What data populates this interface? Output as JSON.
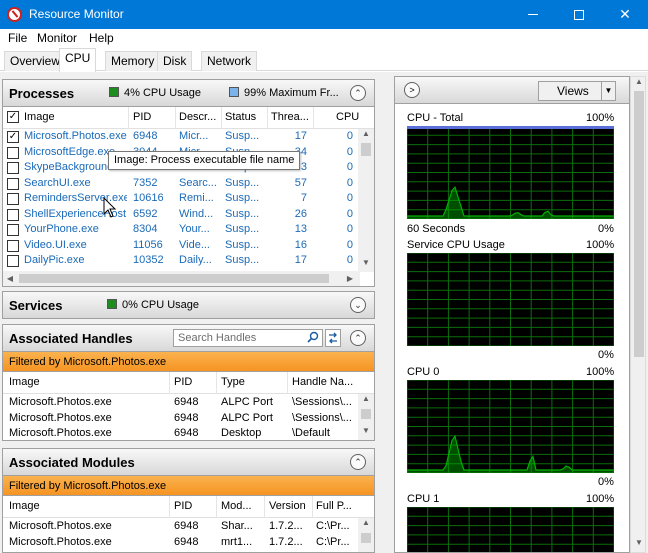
{
  "window": {
    "title": "Resource Monitor"
  },
  "menu": [
    "File",
    "Monitor",
    "Help"
  ],
  "tabs": [
    "Overview",
    "CPU",
    "Memory",
    "Disk",
    "Network"
  ],
  "processes": {
    "title": "Processes",
    "cpu_usage": "4% CPU Usage",
    "max_freq": "99% Maximum Fr...",
    "usage_color": "#1e8c1e",
    "freq_color": "#7ab4ea",
    "columns": [
      "Image",
      "PID",
      "Descr...",
      "Status",
      "Threa...",
      "CPU"
    ],
    "rows": [
      {
        "checked": true,
        "image": "Microsoft.Photos.exe",
        "pid": "6948",
        "desc": "Micr...",
        "status": "Susp...",
        "threads": "17",
        "cpu": "0"
      },
      {
        "checked": false,
        "image": "MicrosoftEdge.exe",
        "pid": "3044",
        "desc": "Micr...",
        "status": "Susp...",
        "threads": "34",
        "cpu": "0"
      },
      {
        "checked": false,
        "image": "SkypeBackgroundHost.exe",
        "pid": "3168",
        "desc": "Micr...",
        "status": "Susp...",
        "threads": "3",
        "cpu": "0"
      },
      {
        "checked": false,
        "image": "SearchUI.exe",
        "pid": "7352",
        "desc": "Searc...",
        "status": "Susp...",
        "threads": "57",
        "cpu": "0"
      },
      {
        "checked": false,
        "image": "RemindersServer.exe",
        "pid": "10616",
        "desc": "Remi...",
        "status": "Susp...",
        "threads": "7",
        "cpu": "0"
      },
      {
        "checked": false,
        "image": "ShellExperienceHost.exe",
        "pid": "6592",
        "desc": "Wind...",
        "status": "Susp...",
        "threads": "26",
        "cpu": "0"
      },
      {
        "checked": false,
        "image": "YourPhone.exe",
        "pid": "8304",
        "desc": "Your...",
        "status": "Susp...",
        "threads": "13",
        "cpu": "0"
      },
      {
        "checked": false,
        "image": "Video.UI.exe",
        "pid": "11056",
        "desc": "Vide...",
        "status": "Susp...",
        "threads": "16",
        "cpu": "0"
      },
      {
        "checked": false,
        "image": "DailyPic.exe",
        "pid": "10352",
        "desc": "Daily...",
        "status": "Susp...",
        "threads": "17",
        "cpu": "0"
      }
    ],
    "tooltip": "Image: Process executable file name"
  },
  "services": {
    "title": "Services",
    "cpu_usage": "0% CPU Usage"
  },
  "handles": {
    "title": "Associated Handles",
    "search_placeholder": "Search Handles",
    "filter": "Filtered by Microsoft.Photos.exe",
    "columns": [
      "Image",
      "PID",
      "Type",
      "Handle Na..."
    ],
    "rows": [
      {
        "image": "Microsoft.Photos.exe",
        "pid": "6948",
        "type": "ALPC Port",
        "name": "\\Sessions\\..."
      },
      {
        "image": "Microsoft.Photos.exe",
        "pid": "6948",
        "type": "ALPC Port",
        "name": "\\Sessions\\..."
      },
      {
        "image": "Microsoft.Photos.exe",
        "pid": "6948",
        "type": "Desktop",
        "name": "\\Default"
      }
    ]
  },
  "modules": {
    "title": "Associated Modules",
    "filter": "Filtered by Microsoft.Photos.exe",
    "columns": [
      "Image",
      "PID",
      "Mod...",
      "Version",
      "Full P..."
    ],
    "rows": [
      {
        "image": "Microsoft.Photos.exe",
        "pid": "6948",
        "mod": "Shar...",
        "version": "1.7.2...",
        "path": "C:\\Pr..."
      },
      {
        "image": "Microsoft.Photos.exe",
        "pid": "6948",
        "mod": "mrt1...",
        "version": "1.7.2...",
        "path": "C:\\Pr..."
      }
    ]
  },
  "graphs": {
    "views_label": "Views",
    "graph_color": "#00b000",
    "items": [
      {
        "title": "CPU - Total",
        "max": "100%",
        "time": "60 Seconds",
        "min": "0%"
      },
      {
        "title": "Service CPU Usage",
        "max": "100%",
        "min": "0%"
      },
      {
        "title": "CPU 0",
        "max": "100%",
        "min": "0%"
      },
      {
        "title": "CPU 1",
        "max": "100%"
      }
    ]
  }
}
